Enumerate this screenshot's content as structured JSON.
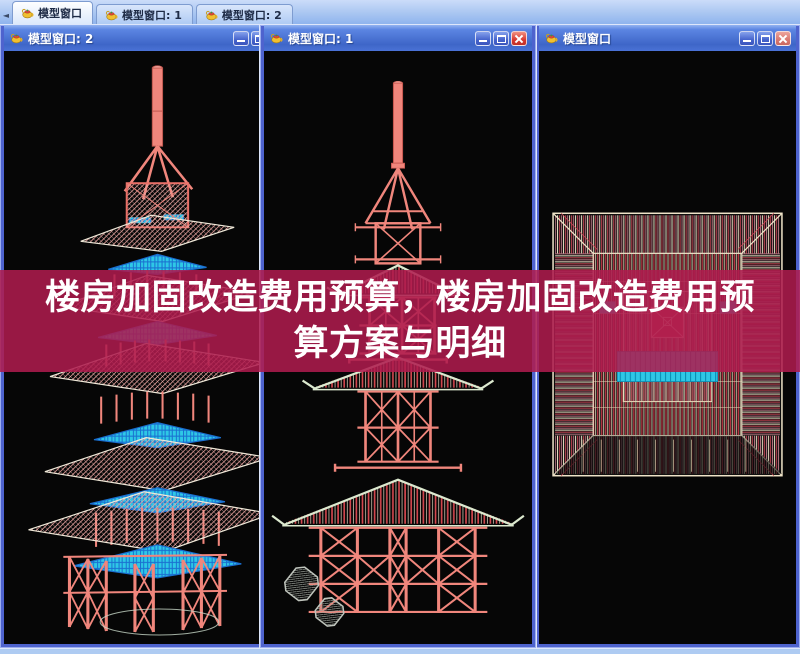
{
  "tab_bar": {
    "scroll_left_icon": "◄",
    "tabs": [
      {
        "label": "模型窗口",
        "active": true
      },
      {
        "label": "模型窗口: 1",
        "active": false
      },
      {
        "label": "模型窗口: 2",
        "active": false
      }
    ]
  },
  "windows": [
    {
      "title": "模型窗口: 2",
      "view": "perspective-wireframe",
      "controls": [
        "minimize",
        "maximize"
      ]
    },
    {
      "title": "模型窗口: 1",
      "view": "front-elevation-wireframe",
      "controls": [
        "minimize",
        "maximize",
        "close"
      ]
    },
    {
      "title": "模型窗口",
      "view": "top-plan-wireframe",
      "controls": [
        "minimize",
        "maximize",
        "close"
      ]
    }
  ],
  "banner": {
    "line1": "楼房加固改造费用预算，楼房加固改造费用预",
    "line2": "算方案与明细"
  },
  "icons": {
    "viewport": "teapot-icon",
    "minimize": "–",
    "maximize": "❐",
    "close": "✕",
    "scroll_left": "◄"
  },
  "colors": {
    "mdi_bg": "#AECBF2",
    "window_border": "#4E63CE",
    "titlebar_top": "#5B85E2",
    "titlebar_bottom": "#3E66C8",
    "close_red": "#D83830",
    "canvas_bg": "#060606",
    "banner_bg": "rgba(175,28,78,0.87)",
    "banner_text": "#FFFFFF",
    "wire_salmon": "#F0867C",
    "wire_pink": "#EDA29E",
    "wire_cyan": "#2EC8E6",
    "wire_cream": "#EFE3C8"
  }
}
